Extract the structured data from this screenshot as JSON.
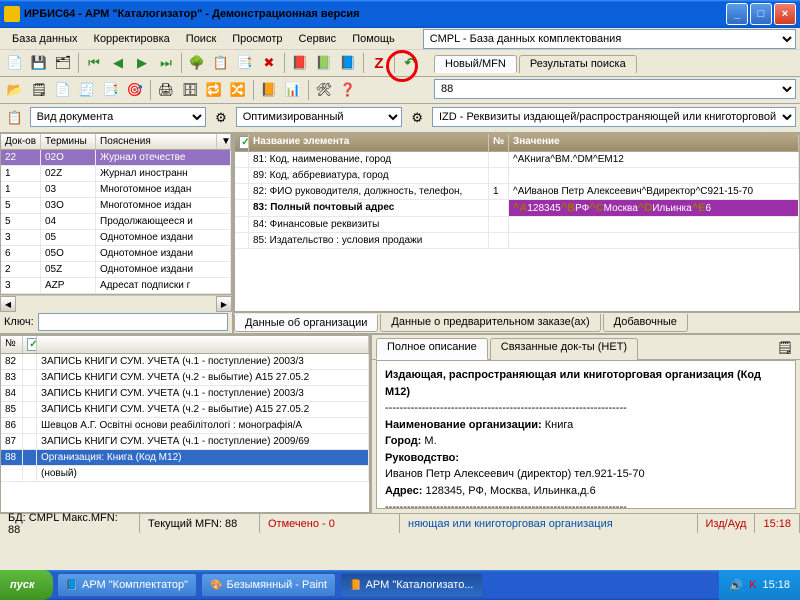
{
  "title": "ИРБИС64 - АРМ \"Каталогизатор\" - Демонстрационная версия",
  "menu": {
    "db": "База данных",
    "corr": "Корректировка",
    "search": "Поиск",
    "view": "Просмотр",
    "service": "Сервис",
    "help": "Помощь"
  },
  "dbselect": "CMPL - База данных комплектования",
  "tabs1": {
    "new": "Новый/MFN",
    "results": "Результаты поиска"
  },
  "mfn_input": "88",
  "left_dd1": "Вид документа",
  "left_dd2": "Оптимизированный",
  "right_dd": "IZD - Реквизиты издающей/распространяющей или книготорговой",
  "leftgrid": {
    "hdr": {
      "c1": "Док-ов",
      "c2": "Термины",
      "c3": "Пояснения"
    },
    "rows": [
      {
        "c1": "22",
        "c2": "02O",
        "c3": "Журнал отечестве",
        "sel": true
      },
      {
        "c1": "1",
        "c2": "02Z",
        "c3": "Журнал иностранн"
      },
      {
        "c1": "1",
        "c2": "03",
        "c3": "Многотомное издан"
      },
      {
        "c1": "5",
        "c2": "03O",
        "c3": "Многотомное издан"
      },
      {
        "c1": "5",
        "c2": "04",
        "c3": "Продолжающееся и"
      },
      {
        "c1": "3",
        "c2": "05",
        "c3": "Однотомное издани"
      },
      {
        "c1": "6",
        "c2": "05O",
        "c3": "Однотомное издани"
      },
      {
        "c1": "2",
        "c2": "05Z",
        "c3": "Однотомное издани"
      },
      {
        "c1": "3",
        "c2": "AZP",
        "c3": "Адресат подписки г"
      }
    ]
  },
  "key_label": "Ключ:",
  "maingrid": {
    "hdr": {
      "c1": "Название элемента",
      "c2": "№",
      "c3": "Значение"
    },
    "rows": [
      {
        "c1": "81: Код, наименование, город",
        "c2": "",
        "c3": "^AКнига^BМ.^DM^EM12"
      },
      {
        "c1": "89: Код, аббревиатура, город",
        "c2": "",
        "c3": ""
      },
      {
        "c1": "82: ФИО руководителя, должность, телефон,",
        "c2": "1",
        "c3": "^AИванов Петр Алексеевич^Bдиректор^C921-15-70"
      },
      {
        "c1": "83: Полный почтовый адрес",
        "c2": "",
        "c3": "^A128345^BРФ^CМосква^DИльинка^E6",
        "bold": true,
        "hl": true
      },
      {
        "c1": "84: Финансовые реквизиты",
        "c2": "",
        "c3": ""
      },
      {
        "c1": "85: Издательство : условия продажи",
        "c2": "",
        "c3": ""
      }
    ]
  },
  "bottomtabs": {
    "t1": "Данные об организации",
    "t2": "Данные о предварительном заказе(ах)",
    "t3": "Добавочные"
  },
  "listgrid": {
    "hdr": {
      "c1": "№"
    },
    "rows": [
      {
        "n": "82",
        "t": "ЗАПИСЬ КНИГИ СУМ. УЧЕТА (ч.1 - поступление)   2003/3"
      },
      {
        "n": "83",
        "t": "ЗАПИСЬ КНИГИ СУМ. УЧЕТА (ч.2 - выбытие)   A15 27.05.2"
      },
      {
        "n": "84",
        "t": "ЗАПИСЬ КНИГИ СУМ. УЧЕТА (ч.1 - поступление)   2003/3"
      },
      {
        "n": "85",
        "t": "ЗАПИСЬ КНИГИ СУМ. УЧЕТА (ч.2 - выбытие)   A15 27.05.2"
      },
      {
        "n": "86",
        "t": "Шевцов А.Г. Освітні основи реабілітологі : монографія/А"
      },
      {
        "n": "87",
        "t": "ЗАПИСЬ КНИГИ СУМ. УЧЕТА (ч.1 - поступление)   2009/69"
      },
      {
        "n": "88",
        "t": "Организация: Книга (Код M12)",
        "sel": true
      },
      {
        "n": "",
        "t": "(новый)"
      }
    ]
  },
  "desctabs": {
    "t1": "Полное описание",
    "t2": "Связанные док-ты (НЕТ)"
  },
  "desc": {
    "line1": "Издающая, распространяющая или книготорговая организация (Код M12)",
    "line2a": "Наименование организации:",
    "line2b": " Книга",
    "line3a": "Город:",
    "line3b": " М.",
    "line4a": "Руководство:",
    "line5": "Иванов Петр Алексеевич (директор)   тел.921-15-70",
    "line6a": "Адрес:",
    "line6b": " 128345, РФ, Москва, Ильинка,д.6",
    "dash": "------------------------------------------------------------------"
  },
  "status": {
    "s1": "БД: CMPL Макс.MFN: 88",
    "s2": "Текущий MFN: 88",
    "s3": "Отмечено - 0",
    "s4": "няющая  или книготорговая организация",
    "s5": "Изд/Ауд"
  },
  "taskbar": {
    "start": "пуск",
    "t1": "АРМ \"Комплектатор\"",
    "t2": "Безымянный - Paint",
    "t3": "АРМ \"Каталогизато...",
    "time": "15:18"
  }
}
